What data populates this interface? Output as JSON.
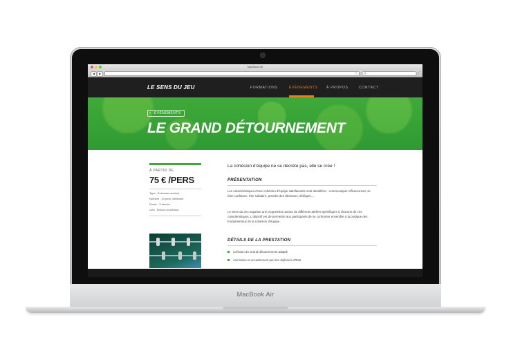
{
  "device": {
    "brand_label": "MacBook Air"
  },
  "browser": {
    "window_title": "MacBook Air",
    "traffic_colors": [
      "#e9544f",
      "#f4be4f",
      "#5cc83b"
    ],
    "back_glyph": "◀",
    "forward_glyph": "▶",
    "reload_glyph": "C",
    "search_glyph": "Q",
    "resize_glyph": "⤢"
  },
  "header": {
    "logo": "LE SENS DU JEU",
    "nav": [
      {
        "label": "FORMATIONS"
      },
      {
        "label": "ÉVÈNEMENTS",
        "active": true
      },
      {
        "label": "À PROPOS"
      },
      {
        "label": "CONTACT"
      }
    ],
    "accent_color": "#f07a1f"
  },
  "hero": {
    "breadcrumb_label": "ÉVÈNEMENTS",
    "breadcrumb_glyph": "‹",
    "title": "LE GRAND DÉTOURNEMENT",
    "background_color": "#3faa39"
  },
  "sidebar": {
    "from_label": "À PARTIR DE",
    "price": "75 € /PERS",
    "info": [
      "Type : Exercices animés",
      "Nombre : 20 pers. minimum",
      "Durée : 3 heures",
      "Lieu : Indoor ou outdoor"
    ]
  },
  "main": {
    "lead": "La cohésion d'équipe ne se décrète pas, elle se crée !",
    "presentation_heading": "PRÉSENTATION",
    "presentation_para1": "Les caractéristiques d'une cohésion d'équipe satisfaisante sont identifiées : communiquer efficacement, se faire confiance, être solidaire, prendre des décisions, déléguer....",
    "presentation_para2": "Le Sens du Jeu organise une progression autour de différents ateliers spécifiques à chacune de ces caractéristiques. L'objectif est de permettre aux participants de se confronter ensemble à la pratique des fondamentaux de la cohésion d'équipe.",
    "details_heading": "DÉTAILS DE LA PRESTATION",
    "details": [
      "Création du Grand détournement adapté",
      "Animation et encadrement par des diplômés d'Etat"
    ]
  }
}
